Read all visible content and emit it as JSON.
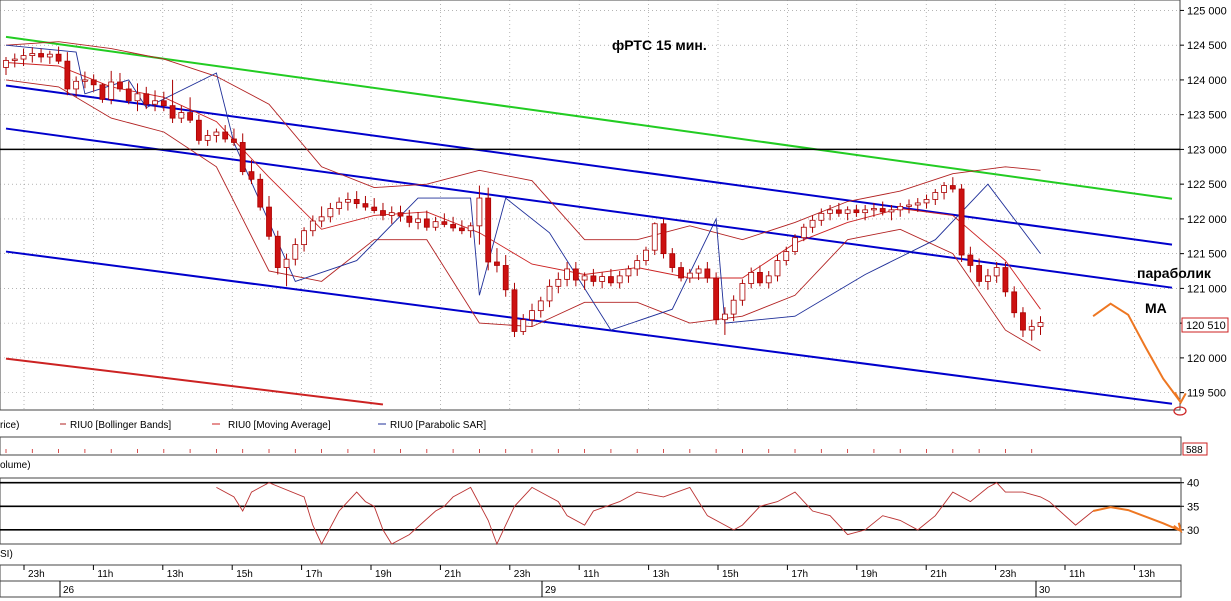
{
  "title": "фРТС   15 мин.",
  "annotations": {
    "parabolic": "параболик",
    "ma": "MA"
  },
  "legend": {
    "price_prefix": "rice)",
    "bollinger": "RIU0 [Bollinger Bands]",
    "moving_average": "RIU0 [Moving Average]",
    "parabolic_sar": "RIU0 [Parabolic SAR]"
  },
  "panels": {
    "volume_label": "olume)",
    "volume_value": "588",
    "rsi_label": "SI)"
  },
  "last_price_label": "120 510",
  "colors": {
    "candle_up": "#ffffff",
    "candle_down": "#cc1111",
    "candle_outline": "#aa0000",
    "bollinger": "#b22222",
    "moving_average": "#cc2222",
    "parabolic_sar": "#1f2f99",
    "channel_blue": "#0000cc",
    "channel_green": "#22cc22",
    "channel_red": "#cc2222",
    "level_line": "#000000",
    "forecast": "#ee7722",
    "grid": "#888888",
    "rsi_line": "#bb3333"
  },
  "time_axis": {
    "hour_labels": [
      "23h",
      "11h",
      "13h",
      "15h",
      "17h",
      "19h",
      "21h",
      "23h",
      "11h",
      "13h",
      "15h",
      "17h",
      "19h",
      "21h",
      "23h",
      "11h",
      "13h"
    ],
    "day_labels": [
      "26",
      "29",
      "30"
    ]
  },
  "chart_data": [
    {
      "type": "candlestick",
      "title": "фРТС   15 мин.",
      "ylim": [
        119250,
        125150
      ],
      "ytick_labels": [
        "125 000",
        "124 500",
        "124 000",
        "123 500",
        "123 000",
        "122 500",
        "122 000",
        "121 500",
        "121 000",
        "120 500",
        "120 000",
        "119 500"
      ],
      "y_ticks": [
        125000,
        124500,
        124000,
        123500,
        123000,
        122500,
        122000,
        121500,
        121000,
        120500,
        120000,
        119500
      ],
      "x_index_range": [
        0,
        133
      ],
      "horizontal_level": 123000,
      "last_price": 120510,
      "candles_ohlc": [
        [
          124180,
          124330,
          124070,
          124280
        ],
        [
          124280,
          124380,
          124180,
          124300
        ],
        [
          124300,
          124450,
          124200,
          124350
        ],
        [
          124350,
          124470,
          124250,
          124380
        ],
        [
          124380,
          124450,
          124250,
          124330
        ],
        [
          124330,
          124420,
          124230,
          124370
        ],
        [
          124370,
          124480,
          124230,
          124270
        ],
        [
          124270,
          124400,
          123780,
          123870
        ],
        [
          123870,
          124050,
          123750,
          123980
        ],
        [
          123980,
          124120,
          123880,
          124000
        ],
        [
          124000,
          124080,
          123830,
          123930
        ],
        [
          123930,
          123950,
          123670,
          123720
        ],
        [
          123720,
          124130,
          123650,
          123970
        ],
        [
          123970,
          124100,
          123830,
          123870
        ],
        [
          123870,
          123980,
          123650,
          123700
        ],
        [
          123700,
          123950,
          123550,
          123800
        ],
        [
          123800,
          123900,
          123580,
          123650
        ],
        [
          123650,
          123850,
          123550,
          123700
        ],
        [
          123700,
          123830,
          123550,
          123630
        ],
        [
          123630,
          124000,
          123380,
          123450
        ],
        [
          123450,
          123630,
          123380,
          123530
        ],
        [
          123530,
          123750,
          123380,
          123420
        ],
        [
          123420,
          123500,
          123070,
          123130
        ],
        [
          123130,
          123280,
          123050,
          123200
        ],
        [
          123200,
          123300,
          123100,
          123250
        ],
        [
          123250,
          123350,
          123100,
          123150
        ],
        [
          123150,
          123300,
          123050,
          123100
        ],
        [
          123100,
          123230,
          122630,
          122680
        ],
        [
          122680,
          122850,
          122500,
          122570
        ],
        [
          122570,
          122650,
          122120,
          122170
        ],
        [
          122170,
          122330,
          121700,
          121750
        ],
        [
          121750,
          121830,
          121200,
          121300
        ],
        [
          121300,
          121500,
          121030,
          121420
        ],
        [
          121420,
          121720,
          121330,
          121630
        ],
        [
          121630,
          121880,
          121530,
          121830
        ],
        [
          121830,
          122050,
          121750,
          121970
        ],
        [
          121970,
          122180,
          121880,
          122030
        ],
        [
          122030,
          122230,
          121950,
          122150
        ],
        [
          122150,
          122310,
          122060,
          122240
        ],
        [
          122240,
          122380,
          122120,
          122280
        ],
        [
          122280,
          122400,
          122150,
          122220
        ],
        [
          122220,
          122330,
          122120,
          122170
        ],
        [
          122170,
          122300,
          122080,
          122120
        ],
        [
          122120,
          122230,
          121980,
          122050
        ],
        [
          122050,
          122180,
          121930,
          122090
        ],
        [
          122090,
          122190,
          121960,
          122040
        ],
        [
          122040,
          122130,
          121880,
          121950
        ],
        [
          121950,
          122100,
          121850,
          122000
        ],
        [
          122000,
          122120,
          121830,
          121880
        ],
        [
          121880,
          122030,
          121830,
          121960
        ],
        [
          121960,
          122080,
          121880,
          121920
        ],
        [
          121920,
          122030,
          121820,
          121870
        ],
        [
          121870,
          121980,
          121780,
          121830
        ],
        [
          121830,
          121950,
          121730,
          121900
        ],
        [
          121900,
          122480,
          121630,
          122300
        ],
        [
          122300,
          122450,
          121260,
          121380
        ],
        [
          121380,
          121580,
          121230,
          121330
        ],
        [
          121330,
          121480,
          120880,
          120980
        ],
        [
          120980,
          121080,
          120300,
          120380
        ],
        [
          120380,
          120630,
          120330,
          120550
        ],
        [
          120550,
          120780,
          120450,
          120680
        ],
        [
          120680,
          120880,
          120580,
          120820
        ],
        [
          120820,
          121130,
          120730,
          121030
        ],
        [
          121030,
          121230,
          120930,
          121130
        ],
        [
          121130,
          121380,
          121030,
          121280
        ],
        [
          121280,
          121380,
          121030,
          121120
        ],
        [
          121120,
          121230,
          120980,
          121180
        ],
        [
          121180,
          121280,
          121030,
          121100
        ],
        [
          121100,
          121230,
          121000,
          121170
        ],
        [
          121170,
          121280,
          121030,
          121080
        ],
        [
          121080,
          121250,
          121000,
          121180
        ],
        [
          121180,
          121330,
          121080,
          121280
        ],
        [
          121280,
          121480,
          121180,
          121400
        ],
        [
          121400,
          121600,
          121330,
          121550
        ],
        [
          121550,
          121950,
          121480,
          121930
        ],
        [
          121930,
          122000,
          121430,
          121500
        ],
        [
          121500,
          121580,
          121230,
          121300
        ],
        [
          121300,
          121380,
          121100,
          121150
        ],
        [
          121150,
          121280,
          121080,
          121220
        ],
        [
          121220,
          121330,
          121120,
          121280
        ],
        [
          121280,
          121380,
          121080,
          121150
        ],
        [
          121150,
          121230,
          120480,
          120550
        ],
        [
          120550,
          120730,
          120330,
          120630
        ],
        [
          120630,
          120900,
          120530,
          120830
        ],
        [
          120830,
          121130,
          120750,
          121070
        ],
        [
          121070,
          121300,
          121000,
          121230
        ],
        [
          121230,
          121330,
          121030,
          121080
        ],
        [
          121080,
          121250,
          121000,
          121180
        ],
        [
          121180,
          121480,
          121100,
          121400
        ],
        [
          121400,
          121600,
          121330,
          121530
        ],
        [
          121530,
          121780,
          121480,
          121730
        ],
        [
          121730,
          121930,
          121680,
          121880
        ],
        [
          121880,
          122050,
          121800,
          121980
        ],
        [
          121980,
          122150,
          121900,
          122080
        ],
        [
          122080,
          122200,
          121980,
          122130
        ],
        [
          122130,
          122230,
          122030,
          122080
        ],
        [
          122080,
          122180,
          121980,
          122130
        ],
        [
          122130,
          122200,
          122030,
          122090
        ],
        [
          122090,
          122200,
          121980,
          122130
        ],
        [
          122130,
          122230,
          122030,
          122150
        ],
        [
          122150,
          122250,
          122050,
          122100
        ],
        [
          122100,
          122200,
          121980,
          122130
        ],
        [
          122130,
          122230,
          122030,
          122180
        ],
        [
          122180,
          122280,
          122080,
          122200
        ],
        [
          122200,
          122300,
          122100,
          122230
        ],
        [
          122230,
          122350,
          122150,
          122280
        ],
        [
          122280,
          122430,
          122200,
          122380
        ],
        [
          122380,
          122530,
          122280,
          122480
        ],
        [
          122480,
          122600,
          122380,
          122430
        ],
        [
          122430,
          122500,
          121380,
          121480
        ],
        [
          121480,
          121600,
          121230,
          121330
        ],
        [
          121330,
          121430,
          121030,
          121100
        ],
        [
          121100,
          121280,
          120980,
          121180
        ],
        [
          121180,
          121380,
          121080,
          121300
        ],
        [
          121300,
          121380,
          120880,
          120950
        ],
        [
          120950,
          121030,
          120580,
          120650
        ],
        [
          120650,
          120730,
          120300,
          120400
        ],
        [
          120400,
          120550,
          120250,
          120450
        ],
        [
          120450,
          120600,
          120330,
          120510
        ]
      ],
      "series": [
        {
          "name": "RIU0 [Bollinger Bands]",
          "x": [
            0,
            6,
            12,
            18,
            24,
            30,
            36,
            42,
            48,
            54,
            60,
            66,
            72,
            78,
            84,
            90,
            96,
            102,
            108,
            114,
            118
          ],
          "upper": [
            124500,
            124550,
            124450,
            124300,
            124050,
            123650,
            122750,
            122450,
            122500,
            122700,
            122550,
            121700,
            121700,
            121900,
            121700,
            121950,
            122250,
            122400,
            122650,
            122750,
            122700
          ],
          "lower": [
            124000,
            123900,
            123450,
            123250,
            122750,
            121250,
            121100,
            121700,
            121700,
            120500,
            120450,
            120800,
            120800,
            120500,
            120600,
            120900,
            121700,
            121850,
            121500,
            120400,
            120100
          ]
        },
        {
          "name": "RIU0 [Moving Average]",
          "x": [
            0,
            6,
            12,
            18,
            24,
            30,
            36,
            42,
            48,
            54,
            60,
            66,
            72,
            78,
            84,
            90,
            96,
            102,
            108,
            114,
            118
          ],
          "values": [
            124250,
            124200,
            123900,
            123750,
            123400,
            122600,
            121850,
            122050,
            122100,
            121800,
            121350,
            121200,
            121300,
            121150,
            121150,
            121650,
            121950,
            122150,
            122050,
            121400,
            120700
          ]
        },
        {
          "name": "RIU0 [Parabolic SAR]",
          "x": [
            0,
            8,
            9,
            14,
            16,
            24,
            26,
            33,
            40,
            47,
            53,
            54,
            57,
            62,
            69,
            76,
            81,
            82,
            90,
            98,
            106,
            112,
            118
          ],
          "values": [
            124500,
            124400,
            123800,
            124000,
            123600,
            124100,
            123100,
            121100,
            121400,
            122300,
            122300,
            120900,
            122300,
            121800,
            120400,
            120700,
            122000,
            120500,
            120600,
            121200,
            121700,
            122500,
            121500
          ]
        }
      ],
      "trendlines": [
        {
          "color_key": "channel_green",
          "x": [
            0,
            133
          ],
          "y": [
            124620,
            122290
          ]
        },
        {
          "color_key": "channel_blue",
          "x": [
            0,
            133
          ],
          "y": [
            123920,
            121630
          ]
        },
        {
          "color_key": "channel_blue",
          "x": [
            0,
            133
          ],
          "y": [
            123300,
            121010
          ]
        },
        {
          "color_key": "channel_blue",
          "x": [
            0,
            133
          ],
          "y": [
            121530,
            119340
          ]
        },
        {
          "color_key": "channel_red",
          "x": [
            0,
            43
          ],
          "y": [
            119990,
            119330
          ]
        }
      ],
      "forecast_x": [
        124,
        126,
        128,
        130,
        132,
        134
      ],
      "forecast_y": [
        120600,
        120780,
        120620,
        120150,
        119700,
        119360
      ]
    },
    {
      "type": "line",
      "ylim": [
        27,
        41
      ],
      "ytick_labels": [
        "40",
        "35",
        "30"
      ],
      "y_ticks": [
        40,
        35,
        30
      ],
      "levels": [
        40,
        35,
        30
      ],
      "series": [
        {
          "name": "",
          "x": [
            24,
            26,
            27,
            28,
            29,
            30,
            34,
            35,
            36,
            38,
            40,
            41,
            42,
            43,
            44,
            46,
            49,
            50,
            51,
            52,
            53,
            55,
            56,
            58,
            60,
            62,
            63,
            64,
            66,
            67,
            70,
            72,
            75,
            78,
            80,
            83,
            84,
            86,
            88,
            90,
            92,
            94,
            96,
            98,
            100,
            102,
            104,
            106,
            108,
            110,
            112,
            113,
            114,
            116,
            118,
            119,
            122,
            124
          ],
          "values": [
            39,
            37,
            34,
            38,
            39,
            40,
            37,
            31,
            27,
            34,
            38,
            36,
            35,
            30,
            27,
            29,
            34,
            35,
            37,
            38,
            39,
            32,
            27,
            35,
            39,
            37,
            36,
            33,
            31,
            34,
            36,
            38,
            37,
            39,
            33,
            30,
            31,
            35,
            36,
            38,
            34,
            33,
            29,
            30,
            33,
            32,
            30,
            33,
            38,
            36,
            39,
            40,
            38,
            38,
            37,
            36,
            31,
            34
          ]
        },
        {
          "name": "",
          "x": [
            124,
            126,
            128,
            130,
            132,
            134
          ],
          "values": [
            34,
            34.8,
            34.2,
            32.8,
            31.4,
            29.8
          ]
        }
      ]
    }
  ]
}
